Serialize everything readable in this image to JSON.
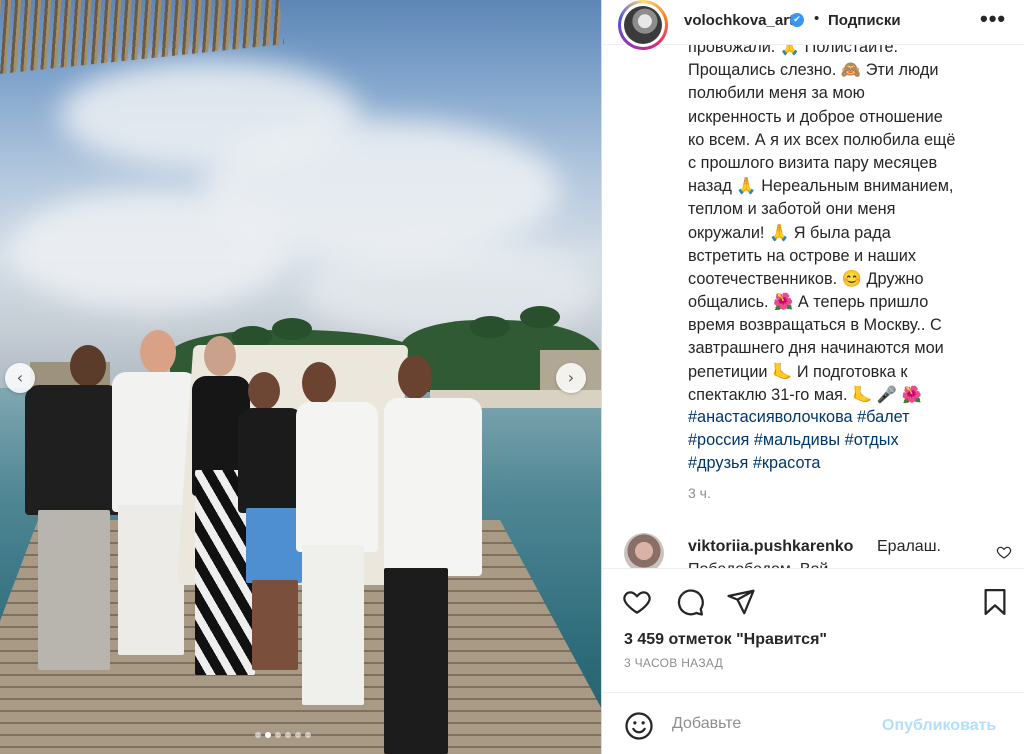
{
  "post": {
    "carousel": {
      "total_slides": 6,
      "active_slide": 2
    },
    "image_alt": ""
  },
  "header": {
    "username": "volochkova_art",
    "verified_mark": "✔",
    "separator": "•",
    "follow_label": "Подписки",
    "more_label": "•••"
  },
  "caption": {
    "lines": [
      "провожали. 🙏 Полистайте.",
      "Прощались слезно. 🙈 Эти люди",
      "полюбили меня за мою",
      "искренность и доброе отношение",
      "ко всем. А я их всех полюбила ещё",
      "с прошлого визита пару месяцев",
      "назад 🙏 Нереальным вниманием,",
      "теплом и заботой они меня",
      "окружали! 🙏 Я была рада",
      "встретить на острове и наших",
      "соотечественников. 😊 Дружно",
      "общались. 🌺 А теперь пришло",
      "время возвращаться в Москву.. С",
      "завтрашнего дня начинаются мои",
      "репетиции 🦶 И подготовка к",
      "спектаклю 31-го мая. 🦶 🎤 🌺"
    ]
  },
  "hashtags": {
    "lines": [
      "#анастасияволочкова #балет",
      "#россия #мальдивы #отдых",
      "#друзья #красота"
    ]
  },
  "post_time": "3 ч.",
  "comment": {
    "username": "viktoriia.pushkarenko",
    "text": "Ералаш.",
    "continuation": "Победобедом. Вой..."
  },
  "actions": {
    "likes_label": "3 459 отметок \"Нравится\"",
    "ago_label": "3 ЧАСОВ НАЗАД"
  },
  "comment_box": {
    "placeholder": "Добавьте",
    "publish_label": "Опубликовать"
  },
  "colors": {
    "link": "#00376b",
    "verified": "#3897f0",
    "publish_disabled": "#b2dffc",
    "muted": "#8e8e8e"
  },
  "icons": [
    "chevron-left-icon",
    "chevron-right-icon",
    "heart-icon",
    "comment-icon",
    "share-icon",
    "bookmark-icon",
    "emoji-icon",
    "more-icon",
    "verified-icon"
  ]
}
